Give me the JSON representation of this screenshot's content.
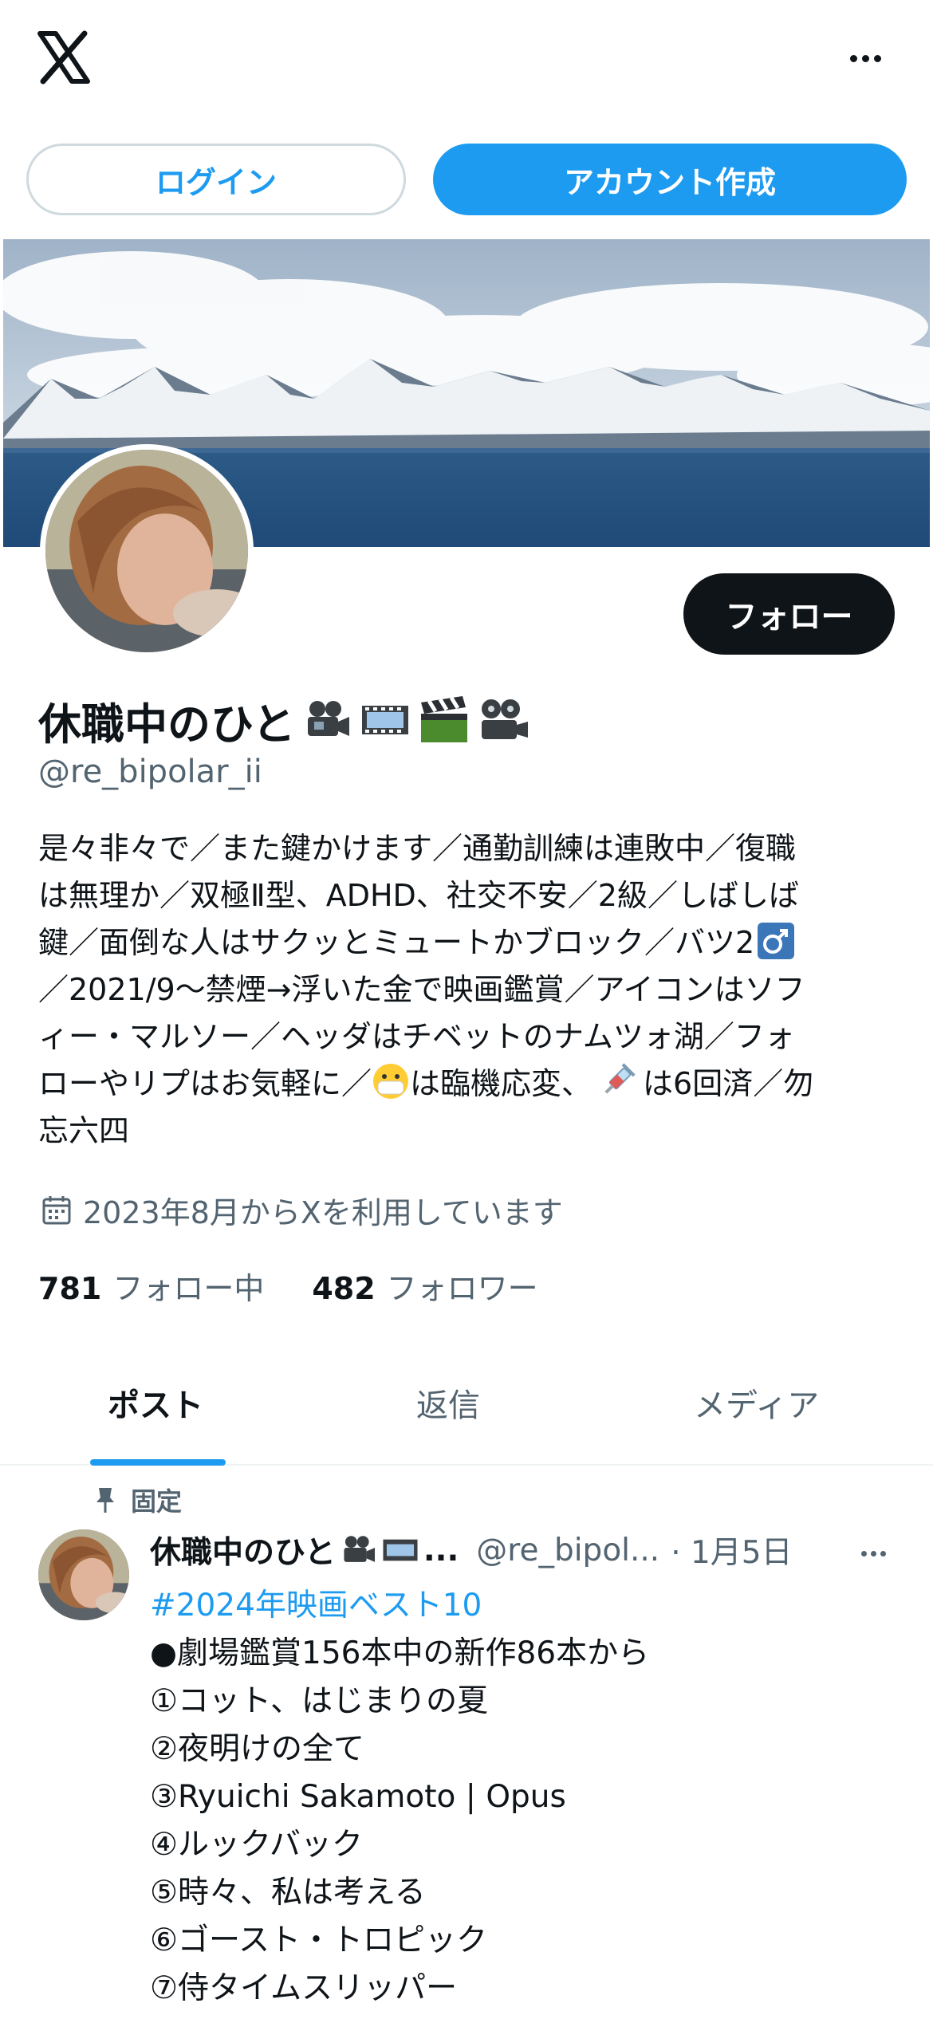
{
  "header": {
    "more_icon": "more-horizontal-icon",
    "logo_icon": "x-logo-icon"
  },
  "auth": {
    "login_label": "ログイン",
    "signup_label": "アカウント作成"
  },
  "profile": {
    "follow_label": "フォロー",
    "display_name": "休職中のひと",
    "handle": "@re_bipolar_ii",
    "bio_lines": [
      "是々非々で／また鍵かけます／通勤訓練は連敗中／復職",
      "は無理か／双極Ⅱ型、ADHD、社交不安／2級／しばしば",
      "鍵／面倒な人はサクッとミュートかブロック／バツ2",
      "／2021/9〜禁煙→浮いた金で映画鑑賞／アイコンはソフ",
      "ィー・マルソー／ヘッダはチベットのナムツォ湖／フォ",
      "ローやリプはお気軽に／",
      "は臨機応変、",
      "は6回済／勿",
      "忘六四"
    ],
    "joined": "2023年8月からXを利用しています",
    "following_count": "781",
    "following_label": "フォロー中",
    "followers_count": "482",
    "followers_label": "フォロワー"
  },
  "tabs": [
    {
      "label": "ポスト",
      "active": true
    },
    {
      "label": "返信",
      "active": false
    },
    {
      "label": "メディア",
      "active": false
    }
  ],
  "pinned_post": {
    "pinned_label": "固定",
    "author_name": "休職中のひと",
    "ellipsis": "...",
    "handle": "@re_bipol...",
    "date": "· 1月5日",
    "hashtag": "#2024年映画ベスト10",
    "lines": [
      "●劇場鑑賞156本中の新作86本から",
      "①コット、はじまりの夏",
      "②夜明けの全て",
      "③Ryuichi Sakamoto | Opus",
      "④ルックバック",
      "⑤時々、私は考える",
      "⑥ゴースト・トロピック",
      "⑦侍タイムスリッパー"
    ]
  },
  "colors": {
    "accent": "#1d9bf0",
    "text": "#0f1419",
    "muted": "#536471",
    "border": "#cfd9de"
  }
}
